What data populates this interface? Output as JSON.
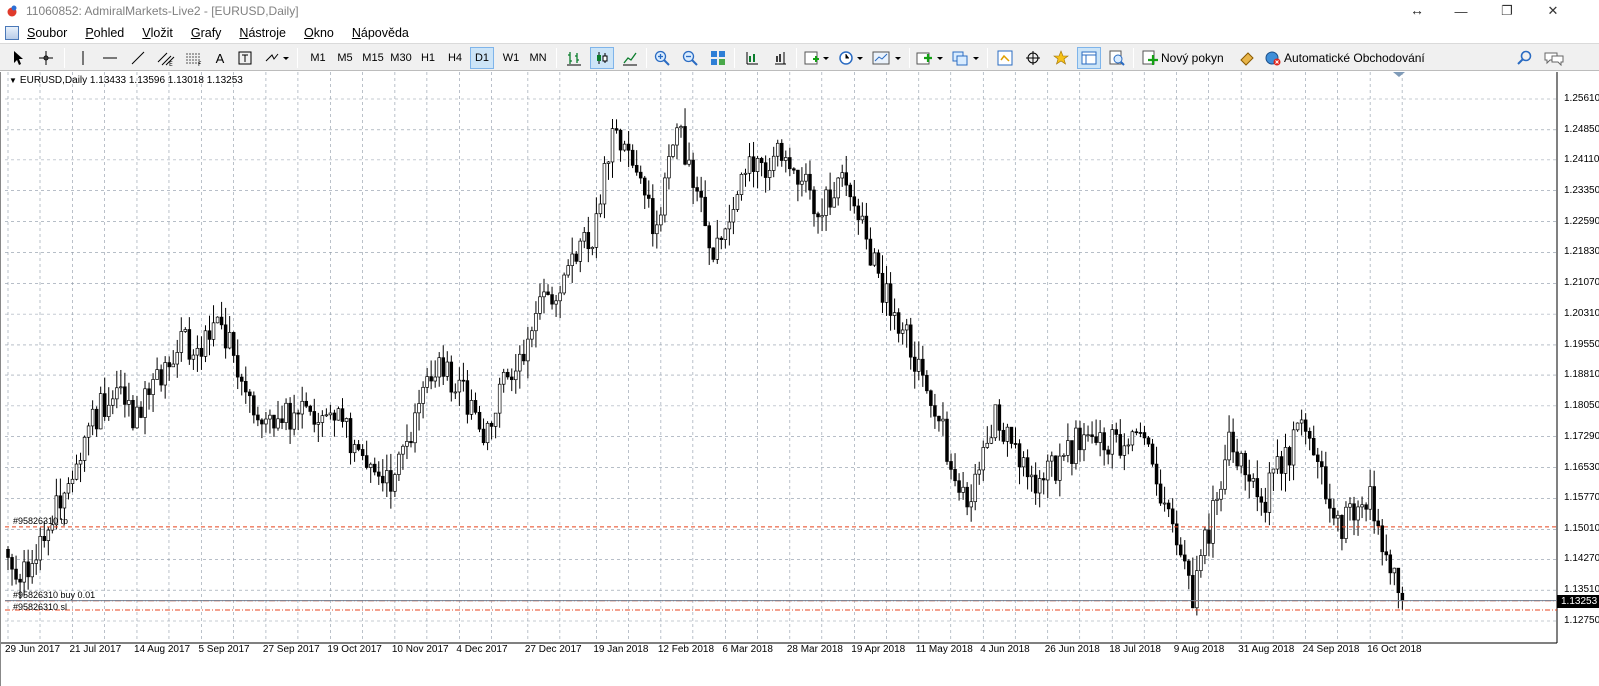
{
  "window": {
    "title": "11060852: AdmiralMarkets-Live2 - [EURUSD,Daily]",
    "resize_glyph": "↔",
    "minimize": "—",
    "maximize": "❐",
    "close": "✕"
  },
  "menu": [
    {
      "accel": "S",
      "rest": "oubor"
    },
    {
      "accel": "P",
      "rest": "ohled"
    },
    {
      "accel": "V",
      "rest": "ložit"
    },
    {
      "accel": "G",
      "rest": "rafy"
    },
    {
      "accel": "N",
      "rest": "ástroje"
    },
    {
      "accel": "O",
      "rest": "kno"
    },
    {
      "accel": "N",
      "rest": "ápověda"
    }
  ],
  "toolbar": {
    "timeframes": [
      "M1",
      "M5",
      "M15",
      "M30",
      "H1",
      "H4",
      "D1",
      "W1",
      "MN"
    ],
    "selected_timeframe": "D1",
    "new_order_label": "Nový pokyn",
    "auto_trading_label": "Automatické Obchodování",
    "text_tool_label": "A"
  },
  "chart": {
    "header": "EURUSD,Daily  1.13433 1.13596 1.13018 1.13253",
    "current_price": "1.13253",
    "order_lines": [
      {
        "label": "#95826310 tp",
        "price": 1.1507
      },
      {
        "label": "#95826310 buy 0.01",
        "price": 1.1325
      },
      {
        "label": "#95826310 sl",
        "price": 1.1302
      }
    ],
    "colors": {
      "grid": "#8c98a6",
      "candle": "#000000",
      "order_line": "#e8431c",
      "price_line": "#6f7f93"
    }
  },
  "chart_data": {
    "type": "candlestick",
    "symbol": "EURUSD",
    "timeframe": "Daily",
    "last": {
      "open": 1.13433,
      "high": 1.13596,
      "low": 1.13018,
      "close": 1.13253
    },
    "ylim": [
      1.1275,
      1.2561
    ],
    "y_ticks": [
      "1.25610",
      "1.24850",
      "1.24110",
      "1.23350",
      "1.22590",
      "1.21830",
      "1.21070",
      "1.20310",
      "1.19550",
      "1.18810",
      "1.18050",
      "1.17290",
      "1.16530",
      "1.15770",
      "1.15010",
      "1.14270",
      "1.13510",
      "1.12750"
    ],
    "x_ticks": [
      "29 Jun 2017",
      "21 Jul 2017",
      "14 Aug 2017",
      "5 Sep 2017",
      "27 Sep 2017",
      "19 Oct 2017",
      "10 Nov 2017",
      "4 Dec 2017",
      "27 Dec 2017",
      "19 Jan 2018",
      "12 Feb 2018",
      "6 Mar 2018",
      "28 Mar 2018",
      "19 Apr 2018",
      "11 May 2018",
      "4 Jun 2018",
      "26 Jun 2018",
      "18 Jul 2018",
      "9 Aug 2018",
      "31 Aug 2018",
      "24 Sep 2018",
      "16 Oct 2018"
    ],
    "close_waypoints": [
      {
        "date": "29 Jun 2017",
        "close": 1.143
      },
      {
        "date": "6 Jul 2017",
        "close": 1.137
      },
      {
        "date": "21 Jul 2017",
        "close": 1.166
      },
      {
        "date": "3 Aug 2017",
        "close": 1.184
      },
      {
        "date": "14 Aug 2017",
        "close": 1.178
      },
      {
        "date": "29 Aug 2017",
        "close": 1.198
      },
      {
        "date": "5 Sep 2017",
        "close": 1.192
      },
      {
        "date": "8 Sep 2017",
        "close": 1.204
      },
      {
        "date": "27 Sep 2017",
        "close": 1.176
      },
      {
        "date": "19 Oct 2017",
        "close": 1.18
      },
      {
        "date": "7 Nov 2017",
        "close": 1.158
      },
      {
        "date": "27 Nov 2017",
        "close": 1.193
      },
      {
        "date": "12 Dec 2017",
        "close": 1.175
      },
      {
        "date": "2 Jan 2018",
        "close": 1.206
      },
      {
        "date": "19 Jan 2018",
        "close": 1.224
      },
      {
        "date": "25 Jan 2018",
        "close": 1.248
      },
      {
        "date": "9 Feb 2018",
        "close": 1.225
      },
      {
        "date": "16 Feb 2018",
        "close": 1.249
      },
      {
        "date": "1 Mar 2018",
        "close": 1.22
      },
      {
        "date": "12 Mar 2018",
        "close": 1.237
      },
      {
        "date": "27 Mar 2018",
        "close": 1.244
      },
      {
        "date": "6 Apr 2018",
        "close": 1.228
      },
      {
        "date": "17 Apr 2018",
        "close": 1.238
      },
      {
        "date": "27 Apr 2018",
        "close": 1.212
      },
      {
        "date": "15 May 2018",
        "close": 1.186
      },
      {
        "date": "29 May 2018",
        "close": 1.154
      },
      {
        "date": "7 Jun 2018",
        "close": 1.179
      },
      {
        "date": "21 Jun 2018",
        "close": 1.159
      },
      {
        "date": "9 Jul 2018",
        "close": 1.174
      },
      {
        "date": "31 Jul 2018",
        "close": 1.17
      },
      {
        "date": "15 Aug 2018",
        "close": 1.134
      },
      {
        "date": "28 Aug 2018",
        "close": 1.17
      },
      {
        "date": "7 Sep 2018",
        "close": 1.156
      },
      {
        "date": "24 Sep 2018",
        "close": 1.178
      },
      {
        "date": "4 Oct 2018",
        "close": 1.15
      },
      {
        "date": "16 Oct 2018",
        "close": 1.158
      },
      {
        "date": "26 Oct 2018",
        "close": 1.1325
      }
    ],
    "order_levels": [
      1.1507,
      1.1325,
      1.1302
    ]
  }
}
